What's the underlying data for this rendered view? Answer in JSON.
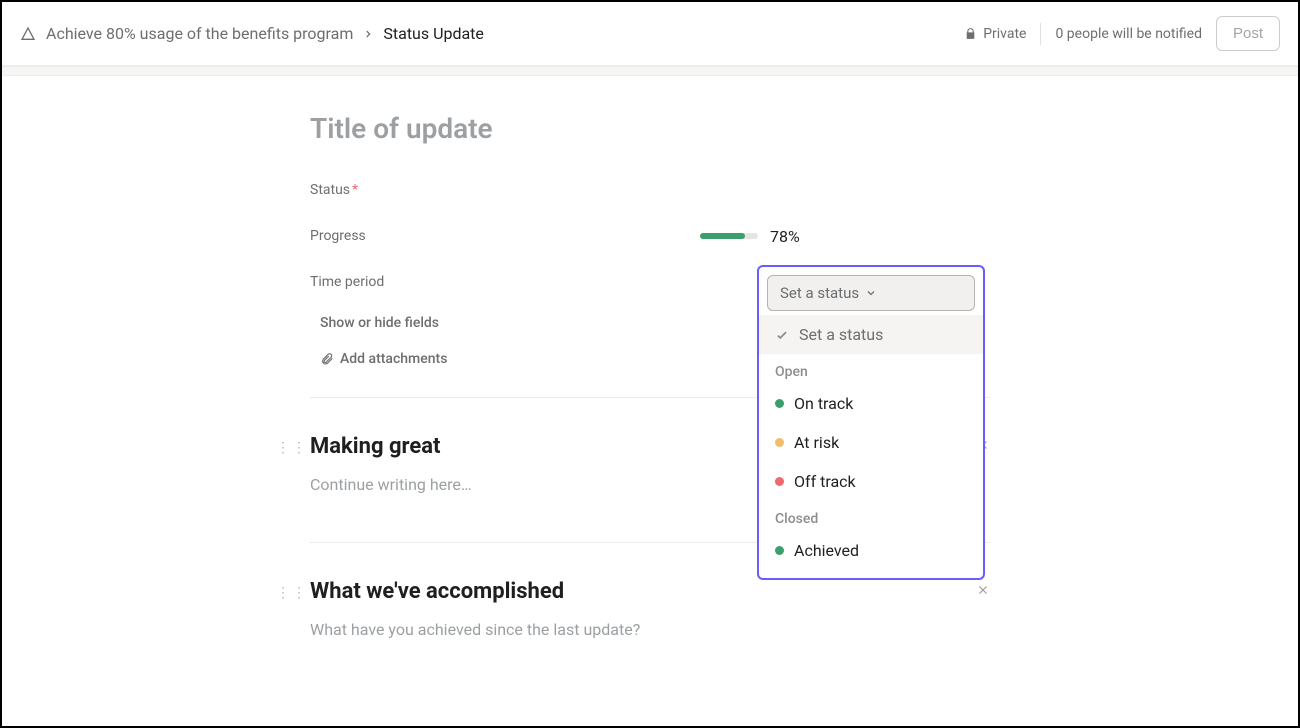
{
  "header": {
    "breadcrumb_goal": "Achieve 80% usage of the benefits program",
    "breadcrumb_current": "Status Update",
    "privacy": "Private",
    "notify_text": "0 people will be notified",
    "post_label": "Post"
  },
  "title_placeholder": "Title of update",
  "fields": {
    "status_label": "Status",
    "status_trigger": "Set a status",
    "progress_label": "Progress",
    "progress_pct": "78%",
    "progress_fill_width": "78%",
    "time_label": "Time period",
    "show_hide": "Show or hide fields",
    "add_attachment": "Add attachments"
  },
  "dropdown": {
    "placeholder": "Set a status",
    "group_open": "Open",
    "group_closed": "Closed",
    "options": {
      "on_track": {
        "label": "On track",
        "color": "#3b9e6d"
      },
      "at_risk": {
        "label": "At risk",
        "color": "#f1bd6c"
      },
      "off_track": {
        "label": "Off track",
        "color": "#ef6a6a"
      },
      "achieved": {
        "label": "Achieved",
        "color": "#3b9e6d"
      }
    }
  },
  "sections": [
    {
      "title": "Making great",
      "placeholder": "Continue writing here…"
    },
    {
      "title": "What we've accomplished",
      "placeholder": "What have you achieved since the last update?"
    }
  ]
}
